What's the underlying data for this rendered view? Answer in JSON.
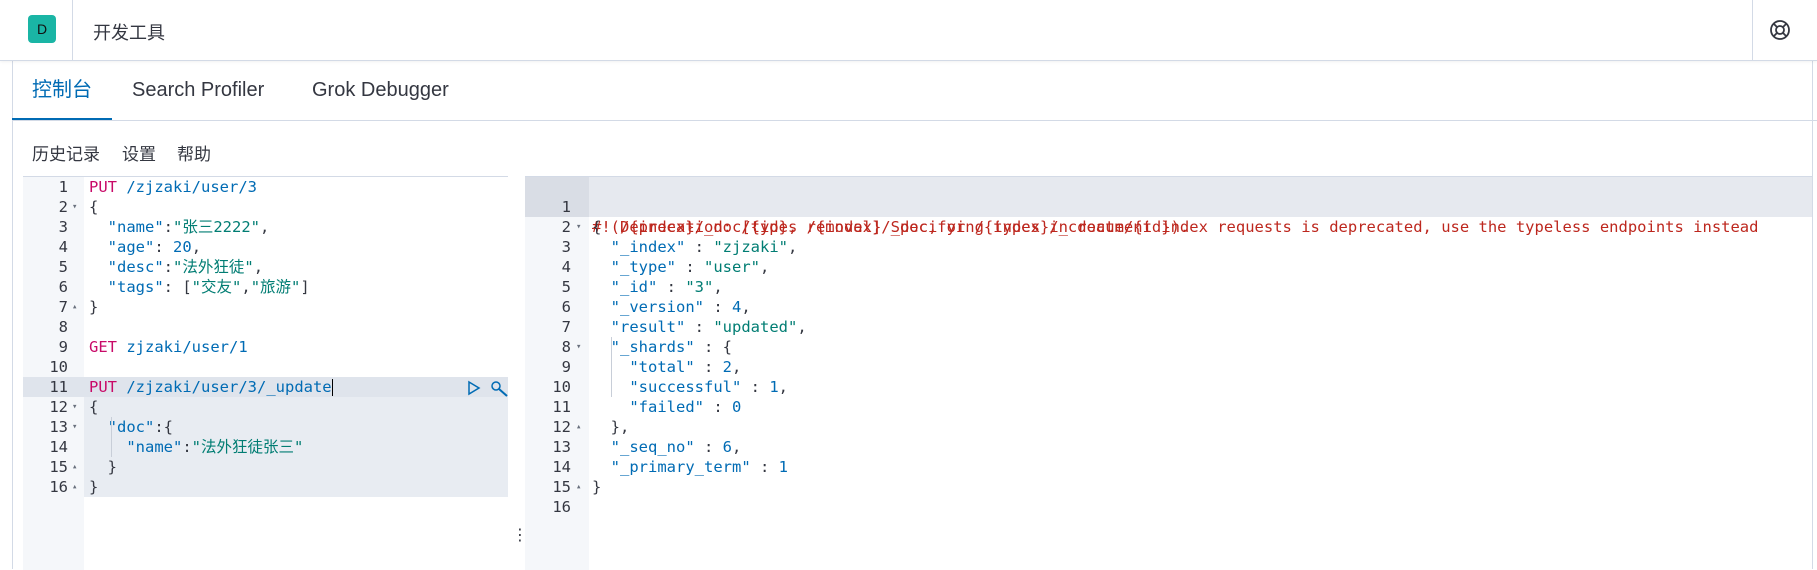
{
  "header": {
    "space_initial": "D",
    "breadcrumb": "开发工具"
  },
  "tabs": [
    {
      "label": "控制台",
      "active": true
    },
    {
      "label": "Search Profiler",
      "active": false
    },
    {
      "label": "Grok Debugger",
      "active": false
    }
  ],
  "toolbar": {
    "history": "历史记录",
    "settings": "设置",
    "help": "帮助"
  },
  "request_editor": {
    "lines": [
      {
        "num": "1",
        "fold": "",
        "text": "PUT /zjzaki/user/3"
      },
      {
        "num": "2",
        "fold": "▾",
        "text": "{"
      },
      {
        "num": "3",
        "fold": "",
        "text": "  \"name\":\"张三2222\","
      },
      {
        "num": "4",
        "fold": "",
        "text": "  \"age\": 20,"
      },
      {
        "num": "5",
        "fold": "",
        "text": "  \"desc\":\"法外狂徒\","
      },
      {
        "num": "6",
        "fold": "",
        "text": "  \"tags\": [\"交友\",\"旅游\"]"
      },
      {
        "num": "7",
        "fold": "▴",
        "text": "}"
      },
      {
        "num": "8",
        "fold": "",
        "text": ""
      },
      {
        "num": "9",
        "fold": "",
        "text": "GET zjzaki/user/1"
      },
      {
        "num": "10",
        "fold": "",
        "text": ""
      },
      {
        "num": "11",
        "fold": "",
        "text": "PUT /zjzaki/user/3/_update"
      },
      {
        "num": "12",
        "fold": "▾",
        "text": "{"
      },
      {
        "num": "13",
        "fold": "▾",
        "text": "  \"doc\":{"
      },
      {
        "num": "14",
        "fold": "",
        "text": "    \"name\":\"法外狂徒张三\""
      },
      {
        "num": "15",
        "fold": "▴",
        "text": "  }"
      },
      {
        "num": "16",
        "fold": "▴",
        "text": "}"
      }
    ]
  },
  "response_editor": {
    "warning_line1": "#! Deprecation: [types removal] Specifying types in document index requests is deprecated, use the typeless endpoints instead",
    "warning_line2": "  (/{index}/_doc/{id}, /{index}/_doc, or /{index}/_create/{id}).",
    "lines": [
      {
        "num": "2",
        "fold": "▾",
        "text": "{"
      },
      {
        "num": "3",
        "fold": "",
        "text": "  \"_index\" : \"zjzaki\","
      },
      {
        "num": "4",
        "fold": "",
        "text": "  \"_type\" : \"user\","
      },
      {
        "num": "5",
        "fold": "",
        "text": "  \"_id\" : \"3\","
      },
      {
        "num": "6",
        "fold": "",
        "text": "  \"_version\" : 4,"
      },
      {
        "num": "7",
        "fold": "",
        "text": "  \"result\" : \"updated\","
      },
      {
        "num": "8",
        "fold": "▾",
        "text": "  \"_shards\" : {"
      },
      {
        "num": "9",
        "fold": "",
        "text": "    \"total\" : 2,"
      },
      {
        "num": "10",
        "fold": "",
        "text": "    \"successful\" : 1,"
      },
      {
        "num": "11",
        "fold": "",
        "text": "    \"failed\" : 0"
      },
      {
        "num": "12",
        "fold": "▴",
        "text": "  },"
      },
      {
        "num": "13",
        "fold": "",
        "text": "  \"_seq_no\" : 6,"
      },
      {
        "num": "14",
        "fold": "",
        "text": "  \"_primary_term\" : 1"
      },
      {
        "num": "15",
        "fold": "▴",
        "text": "}"
      },
      {
        "num": "16",
        "fold": "",
        "text": ""
      }
    ],
    "first_line_num": "1"
  },
  "colors": {
    "accent": "#006bb4",
    "method": "#c80a68",
    "string": "#00a69b",
    "warning": "#bd271e",
    "badge": "#1ab5a5"
  },
  "icons": {
    "run": "play-icon",
    "options": "wrench-icon",
    "help": "lifebuoy-icon"
  }
}
